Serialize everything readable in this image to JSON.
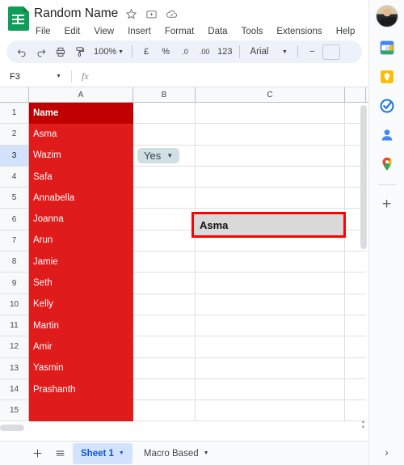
{
  "header": {
    "doc_title": "Random Name",
    "icons": [
      {
        "name": "star-icon",
        "label": "Star"
      },
      {
        "name": "move-to-folder-icon",
        "label": "Move"
      },
      {
        "name": "cloud-saved-icon",
        "label": "Saved to Drive"
      }
    ],
    "menus": [
      "File",
      "Edit",
      "View",
      "Insert",
      "Format",
      "Data",
      "Tools",
      "Extensions",
      "Help"
    ]
  },
  "toolbar": {
    "undo": "Undo",
    "redo": "Redo",
    "print": "Print",
    "paint_format": "Paint format",
    "zoom": "100%",
    "currency": "£",
    "percent": "%",
    "decrease_decimal": ".0",
    "increase_decimal": ".00",
    "number_format": "123",
    "font": "Arial",
    "decrease_font": "−"
  },
  "formula_bar": {
    "name_box": "F3",
    "fx": "fx",
    "formula_value": ""
  },
  "grid": {
    "columns": [
      "A",
      "B",
      "C",
      ""
    ],
    "rows": [
      {
        "n": "1",
        "a": "Name",
        "style": "redhead"
      },
      {
        "n": "2",
        "a": "Asma",
        "style": "red"
      },
      {
        "n": "3",
        "a": "Wazim",
        "style": "red",
        "selected": true
      },
      {
        "n": "4",
        "a": "Safa",
        "style": "red"
      },
      {
        "n": "5",
        "a": "Annabella",
        "style": "red"
      },
      {
        "n": "6",
        "a": "Joanna",
        "style": "red"
      },
      {
        "n": "7",
        "a": "Arun",
        "style": "red"
      },
      {
        "n": "8",
        "a": "Jamie",
        "style": "red"
      },
      {
        "n": "9",
        "a": "Seth",
        "style": "red"
      },
      {
        "n": "10",
        "a": "Kelly",
        "style": "red"
      },
      {
        "n": "11",
        "a": "Martin",
        "style": "red"
      },
      {
        "n": "12",
        "a": "Amir",
        "style": "red"
      },
      {
        "n": "13",
        "a": "Yasmin",
        "style": "red"
      },
      {
        "n": "14",
        "a": "Prashanth",
        "style": "red"
      },
      {
        "n": "15",
        "a": "",
        "style": "red"
      }
    ],
    "dropdown_chip": {
      "value": "Yes",
      "cell": "B3"
    },
    "highlighted_cell": {
      "value": "Asma",
      "fill": "#d9d9d9",
      "outline": "#ff0000"
    }
  },
  "sheet_bar": {
    "add_sheet": "+",
    "all_sheets": "All sheets",
    "tabs": [
      {
        "label": "Sheet 1",
        "active": true
      },
      {
        "label": "Macro Based",
        "active": false
      }
    ]
  },
  "sidebar": {
    "avatar": "User avatar",
    "items": [
      {
        "name": "google-calendar-icon",
        "label": "Calendar"
      },
      {
        "name": "google-keep-icon",
        "label": "Keep"
      },
      {
        "name": "google-tasks-icon",
        "label": "Tasks"
      },
      {
        "name": "google-contacts-icon",
        "label": "Contacts"
      },
      {
        "name": "google-maps-icon",
        "label": "Maps"
      }
    ],
    "add_label": "+",
    "expand_label": "›"
  }
}
